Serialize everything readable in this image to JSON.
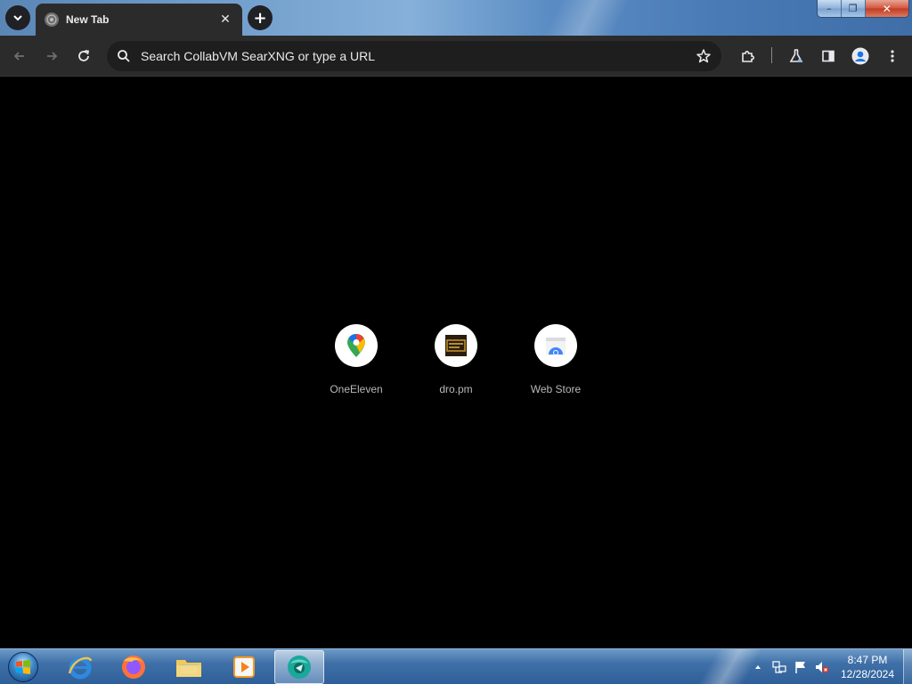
{
  "browser": {
    "tab": {
      "title": "New Tab",
      "close_glyph": "✕"
    },
    "new_tab_glyph": "+",
    "omnibox": {
      "placeholder": "Search CollabVM SearXNG or type a URL"
    },
    "window_controls": {
      "minimize": "–",
      "maximize": "❐",
      "close": "✕"
    },
    "shortcuts": [
      {
        "label": "OneEleven",
        "icon": "google-maps-icon"
      },
      {
        "label": "dro.pm",
        "icon": "dro-pm-icon"
      },
      {
        "label": "Web Store",
        "icon": "web-store-icon"
      }
    ]
  },
  "taskbar": {
    "apps": [
      {
        "name": "internet-explorer",
        "icon": "ie-icon"
      },
      {
        "name": "firefox",
        "icon": "firefox-icon"
      },
      {
        "name": "file-explorer",
        "icon": "folder-icon"
      },
      {
        "name": "media-player",
        "icon": "media-player-icon"
      },
      {
        "name": "chromium-browser",
        "icon": "browser-icon"
      }
    ],
    "clock": {
      "time": "8:47 PM",
      "date": "12/28/2024"
    }
  },
  "colors": {
    "toolbar_bg": "#2b2b2b",
    "omnibox_bg": "#1e1e1e",
    "content_bg": "#000000",
    "shortcut_label": "#b8b8b8"
  }
}
